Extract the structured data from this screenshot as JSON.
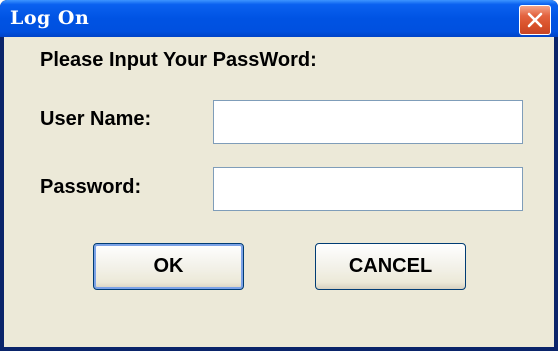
{
  "window": {
    "title": "Log On",
    "close_icon": "close-icon"
  },
  "form": {
    "prompt": "Please Input Your PassWord:",
    "user_name_label": "User Name:",
    "user_name_value": "",
    "password_label": "Password:",
    "password_value": ""
  },
  "buttons": {
    "ok_label": "OK",
    "cancel_label": "CANCEL"
  },
  "colors": {
    "titlebar": "#0053e3",
    "close_button": "#d8512a",
    "dialog_background": "#ece9d8",
    "button_border": "#003c74"
  }
}
